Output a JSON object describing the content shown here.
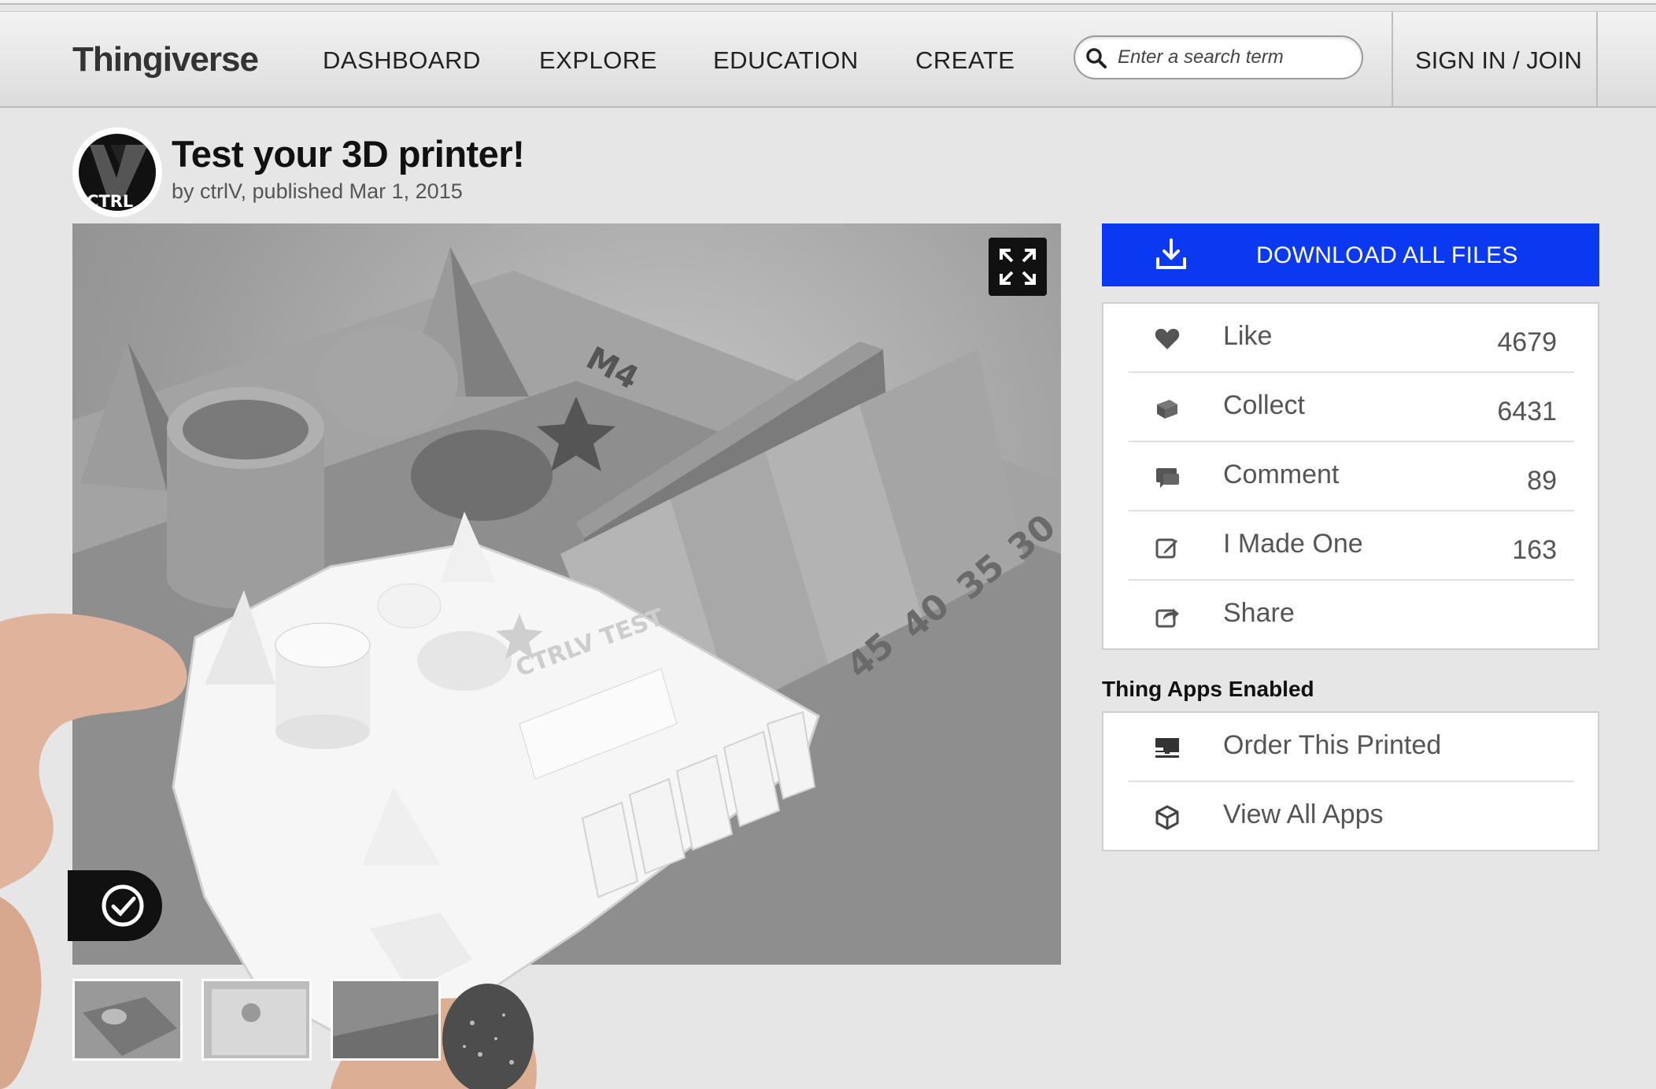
{
  "nav": {
    "logo": "Thingiverse",
    "items": [
      "DASHBOARD",
      "EXPLORE",
      "EDUCATION",
      "CREATE"
    ],
    "search_placeholder": "Enter a search term",
    "signin": "SIGN IN / JOIN"
  },
  "thing": {
    "avatar_text": "CTRL",
    "title": "Test your 3D printer!",
    "byline": "by ctrlV, published Mar 1, 2015"
  },
  "actions": {
    "download_label": "DOWNLOAD ALL FILES",
    "stats": [
      {
        "label": "Like",
        "count": "4679",
        "icon": "heart-icon"
      },
      {
        "label": "Collect",
        "count": "6431",
        "icon": "collect-icon"
      },
      {
        "label": "Comment",
        "count": "89",
        "icon": "comment-icon"
      },
      {
        "label": "I Made One",
        "count": "163",
        "icon": "edit-icon"
      },
      {
        "label": "Share",
        "count": "",
        "icon": "share-icon"
      }
    ]
  },
  "apps": {
    "title": "Thing Apps Enabled",
    "items": [
      {
        "label": "Order This Printed",
        "icon": "printer-icon"
      },
      {
        "label": "View All Apps",
        "icon": "cube-icon"
      }
    ]
  },
  "image_text": {
    "model_label": "CTRLV TEST",
    "m4": "M4",
    "angles": [
      "45",
      "40",
      "35",
      "30"
    ]
  },
  "colors": {
    "accent": "#0b39f2",
    "page_bg": "#e6e6e6"
  }
}
